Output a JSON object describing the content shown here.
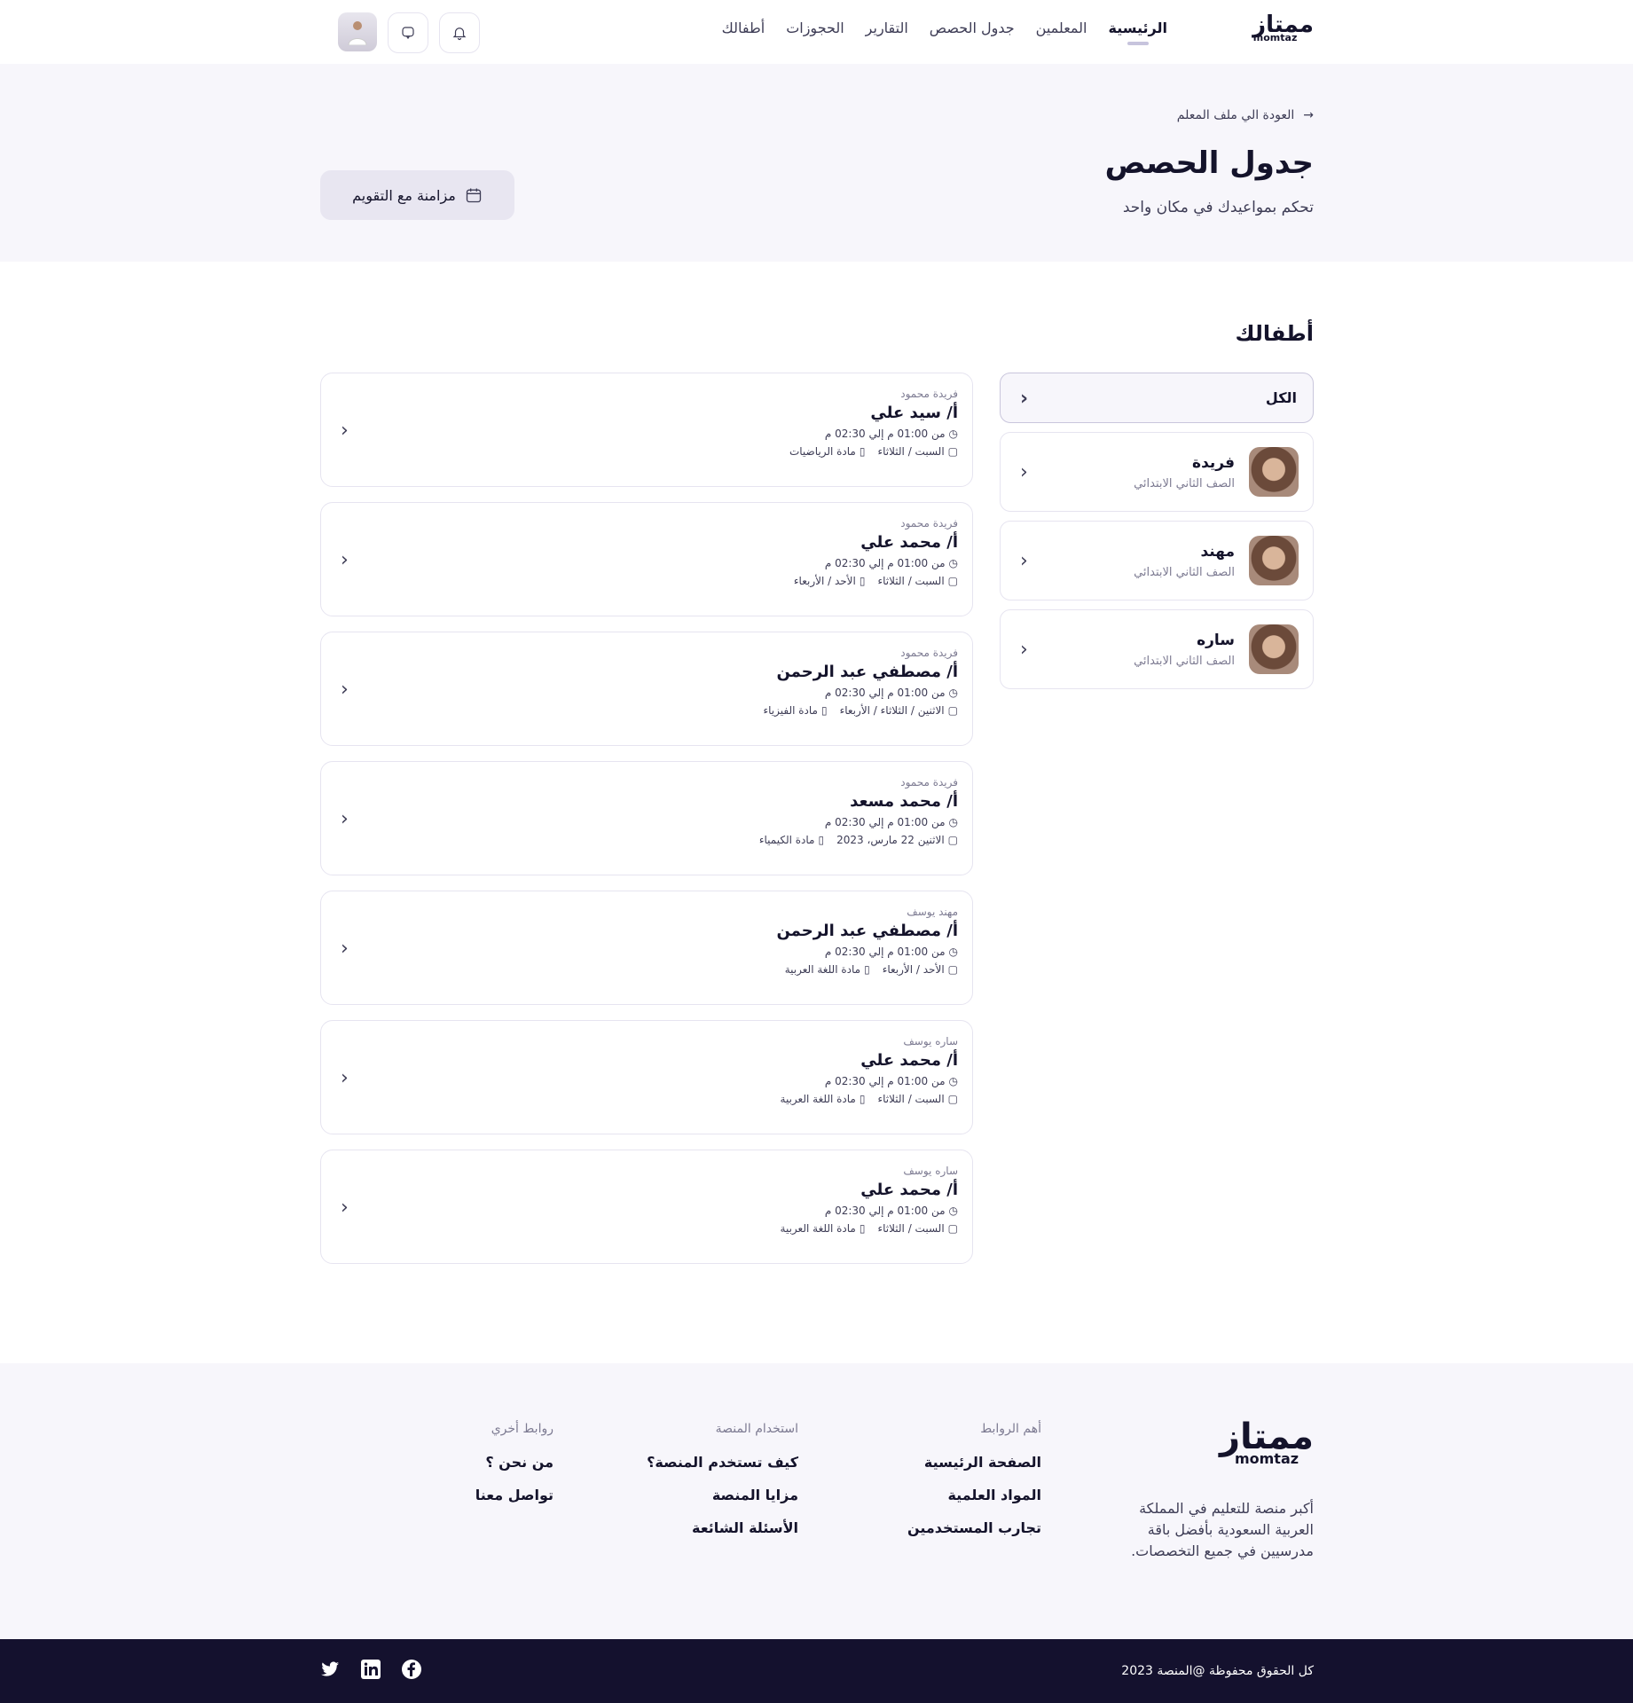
{
  "nav": {
    "logo_ar": "ممتاز",
    "logo_en": "momtaz",
    "items": [
      "الرئيسية",
      "المعلمين",
      "جدول الحصص",
      "التقارير",
      "الحجوزات",
      "أطفالك"
    ],
    "active": 0
  },
  "hero": {
    "back": "العودة الي ملف المعلم",
    "title": "جدول الحصص",
    "subtitle": "تحكم بمواعيدك في مكان واحد",
    "sync": "مزامنة مع التقويم"
  },
  "section_title": "أطفالك",
  "kids": {
    "all": "الكل",
    "items": [
      {
        "name": "فريدة",
        "grade": "الصف الثاني الابتدائي"
      },
      {
        "name": "مهند",
        "grade": "الصف الثاني الابتدائي"
      },
      {
        "name": "ساره",
        "grade": "الصف الثاني الابتدائي"
      }
    ]
  },
  "sessions": [
    {
      "kid": "فريدة محمود",
      "teacher": "أ/ سيد علي",
      "time": "من 01:00 م إلي 02:30 م",
      "days": "السبت / الثلاثاء",
      "subject": "مادة الرياضيات"
    },
    {
      "kid": "فريدة محمود",
      "teacher": "أ/ محمد علي",
      "time": "من 01:00 م إلي 02:30 م",
      "days": "السبت / الثلاثاء",
      "subject": "الأحد / الأربعاء"
    },
    {
      "kid": "فريدة محمود",
      "teacher": "أ/ مصطفي عبد الرحمن",
      "time": "من 01:00 م إلي 02:30 م",
      "days": "الاثنين / الثلاثاء / الأربعاء",
      "subject": "مادة الفيزياء"
    },
    {
      "kid": "فريدة محمود",
      "teacher": "أ/ محمد مسعد",
      "time": "من 01:00 م إلي 02:30 م",
      "days": "الاثنين 22 مارس، 2023",
      "subject": "مادة الكيمياء"
    },
    {
      "kid": "مهند يوسف",
      "teacher": "أ/ مصطفي عبد الرحمن",
      "time": "من 01:00 م إلي 02:30 م",
      "days": "الأحد / الأربعاء",
      "subject": "مادة اللغة العربية"
    },
    {
      "kid": "ساره يوسف",
      "teacher": "أ/ محمد علي",
      "time": "من 01:00 م إلي 02:30 م",
      "days": "السبت / الثلاثاء",
      "subject": "مادة اللغة العربية"
    },
    {
      "kid": "ساره يوسف",
      "teacher": "أ/ محمد علي",
      "time": "من 01:00 م إلي 02:30 م",
      "days": "السبت / الثلاثاء",
      "subject": "مادة اللغة العربية"
    }
  ],
  "footer": {
    "description": "أكبر منصة للتعليم في المملكة العربية السعودية بأفضل باقة مدرسيين في جميع التخصصات.",
    "columns": [
      {
        "heading": "أهم الروابط",
        "links": [
          "الصفحة الرئيسية",
          "المواد العلمية",
          "تجارب المستخدمين"
        ]
      },
      {
        "heading": "استخدام المنصة",
        "links": [
          "كيف تستخدم المنصة؟",
          "مزايا المنصة",
          "الأسئلة الشائعة"
        ]
      },
      {
        "heading": "روابط أخري",
        "links": [
          "من نحن ؟",
          "تواصل معنا"
        ]
      }
    ],
    "copyright": "كل الحقوق محفوظة @المنصة 2023",
    "social": [
      "twitter-icon",
      "linkedin-icon",
      "facebook-icon"
    ]
  },
  "colors": {
    "dark": "#14112e",
    "light_bg": "#f7f6fb",
    "border": "#e6e4f0"
  }
}
